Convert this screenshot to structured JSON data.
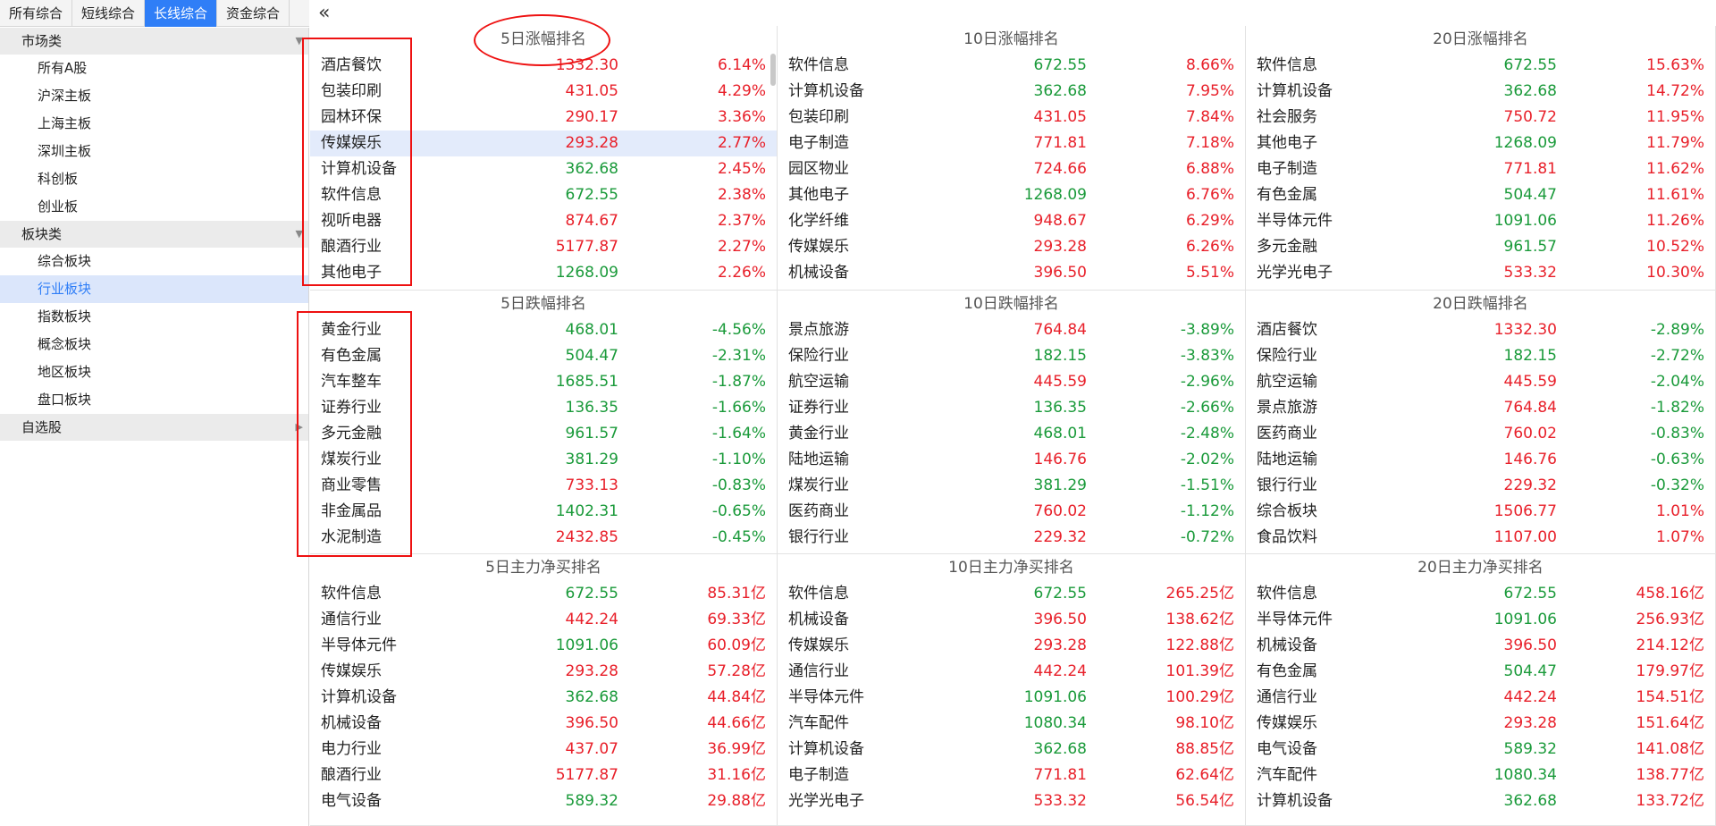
{
  "tabs": [
    "所有综合",
    "短线综合",
    "长线综合",
    "资金综合"
  ],
  "active_tab": 2,
  "collapse_glyph": "«",
  "sidebar": {
    "groups": [
      {
        "label": "市场类",
        "items": [
          "所有A股",
          "沪深主板",
          "上海主板",
          "深圳主板",
          "科创板",
          "创业板"
        ]
      },
      {
        "label": "板块类",
        "items": [
          "综合板块",
          "行业板块",
          "指数板块",
          "概念板块",
          "地区板块",
          "盘口板块"
        ]
      },
      {
        "label": "自选股",
        "items": []
      }
    ],
    "active_item": "行业板块"
  },
  "panels": [
    {
      "title": "5日涨幅排名",
      "rows": [
        [
          "酒店餐饮",
          "1332.30",
          "6.14%",
          "up",
          "up"
        ],
        [
          "包装印刷",
          "431.05",
          "4.29%",
          "up",
          "up"
        ],
        [
          "园林环保",
          "290.17",
          "3.36%",
          "up",
          "up"
        ],
        [
          "传媒娱乐",
          "293.28",
          "2.77%",
          "up",
          "up"
        ],
        [
          "计算机设备",
          "362.68",
          "2.45%",
          "dn",
          "up"
        ],
        [
          "软件信息",
          "672.55",
          "2.38%",
          "dn",
          "up"
        ],
        [
          "视听电器",
          "874.67",
          "2.37%",
          "up",
          "up"
        ],
        [
          "酿酒行业",
          "5177.87",
          "2.27%",
          "up",
          "up"
        ],
        [
          "其他电子",
          "1268.09",
          "2.26%",
          "dn",
          "up"
        ]
      ]
    },
    {
      "title": "10日涨幅排名",
      "rows": [
        [
          "软件信息",
          "672.55",
          "8.66%",
          "dn",
          "up"
        ],
        [
          "计算机设备",
          "362.68",
          "7.95%",
          "dn",
          "up"
        ],
        [
          "包装印刷",
          "431.05",
          "7.84%",
          "up",
          "up"
        ],
        [
          "电子制造",
          "771.81",
          "7.18%",
          "up",
          "up"
        ],
        [
          "园区物业",
          "724.66",
          "6.88%",
          "up",
          "up"
        ],
        [
          "其他电子",
          "1268.09",
          "6.76%",
          "dn",
          "up"
        ],
        [
          "化学纤维",
          "948.67",
          "6.29%",
          "up",
          "up"
        ],
        [
          "传媒娱乐",
          "293.28",
          "6.26%",
          "up",
          "up"
        ],
        [
          "机械设备",
          "396.50",
          "5.51%",
          "up",
          "up"
        ]
      ]
    },
    {
      "title": "20日涨幅排名",
      "rows": [
        [
          "软件信息",
          "672.55",
          "15.63%",
          "dn",
          "up"
        ],
        [
          "计算机设备",
          "362.68",
          "14.72%",
          "dn",
          "up"
        ],
        [
          "社会服务",
          "750.72",
          "11.95%",
          "up",
          "up"
        ],
        [
          "其他电子",
          "1268.09",
          "11.79%",
          "dn",
          "up"
        ],
        [
          "电子制造",
          "771.81",
          "11.62%",
          "up",
          "up"
        ],
        [
          "有色金属",
          "504.47",
          "11.61%",
          "dn",
          "up"
        ],
        [
          "半导体元件",
          "1091.06",
          "11.26%",
          "dn",
          "up"
        ],
        [
          "多元金融",
          "961.57",
          "10.52%",
          "dn",
          "up"
        ],
        [
          "光学光电子",
          "533.32",
          "10.30%",
          "up",
          "up"
        ]
      ]
    },
    {
      "title": "5日跌幅排名",
      "rows": [
        [
          "黄金行业",
          "468.01",
          "-4.56%",
          "dn",
          "dn"
        ],
        [
          "有色金属",
          "504.47",
          "-2.31%",
          "dn",
          "dn"
        ],
        [
          "汽车整车",
          "1685.51",
          "-1.87%",
          "dn",
          "dn"
        ],
        [
          "证券行业",
          "136.35",
          "-1.66%",
          "dn",
          "dn"
        ],
        [
          "多元金融",
          "961.57",
          "-1.64%",
          "dn",
          "dn"
        ],
        [
          "煤炭行业",
          "381.29",
          "-1.10%",
          "dn",
          "dn"
        ],
        [
          "商业零售",
          "733.13",
          "-0.83%",
          "up",
          "dn"
        ],
        [
          "非金属品",
          "1402.31",
          "-0.65%",
          "dn",
          "dn"
        ],
        [
          "水泥制造",
          "2432.85",
          "-0.45%",
          "up",
          "dn"
        ]
      ]
    },
    {
      "title": "10日跌幅排名",
      "rows": [
        [
          "景点旅游",
          "764.84",
          "-3.89%",
          "up",
          "dn"
        ],
        [
          "保险行业",
          "182.15",
          "-3.83%",
          "dn",
          "dn"
        ],
        [
          "航空运输",
          "445.59",
          "-2.96%",
          "up",
          "dn"
        ],
        [
          "证券行业",
          "136.35",
          "-2.66%",
          "dn",
          "dn"
        ],
        [
          "黄金行业",
          "468.01",
          "-2.48%",
          "dn",
          "dn"
        ],
        [
          "陆地运输",
          "146.76",
          "-2.02%",
          "up",
          "dn"
        ],
        [
          "煤炭行业",
          "381.29",
          "-1.51%",
          "dn",
          "dn"
        ],
        [
          "医药商业",
          "760.02",
          "-1.12%",
          "up",
          "dn"
        ],
        [
          "银行行业",
          "229.32",
          "-0.72%",
          "up",
          "dn"
        ]
      ]
    },
    {
      "title": "20日跌幅排名",
      "rows": [
        [
          "酒店餐饮",
          "1332.30",
          "-2.89%",
          "up",
          "dn"
        ],
        [
          "保险行业",
          "182.15",
          "-2.72%",
          "dn",
          "dn"
        ],
        [
          "航空运输",
          "445.59",
          "-2.04%",
          "up",
          "dn"
        ],
        [
          "景点旅游",
          "764.84",
          "-1.82%",
          "up",
          "dn"
        ],
        [
          "医药商业",
          "760.02",
          "-0.83%",
          "up",
          "dn"
        ],
        [
          "陆地运输",
          "146.76",
          "-0.63%",
          "up",
          "dn"
        ],
        [
          "银行行业",
          "229.32",
          "-0.32%",
          "up",
          "dn"
        ],
        [
          "综合板块",
          "1506.77",
          "1.01%",
          "up",
          "up"
        ],
        [
          "食品饮料",
          "1107.00",
          "1.07%",
          "up",
          "up"
        ]
      ]
    },
    {
      "title": "5日主力净买排名",
      "rows": [
        [
          "软件信息",
          "672.55",
          "85.31亿",
          "dn",
          "up"
        ],
        [
          "通信行业",
          "442.24",
          "69.33亿",
          "up",
          "up"
        ],
        [
          "半导体元件",
          "1091.06",
          "60.09亿",
          "dn",
          "up"
        ],
        [
          "传媒娱乐",
          "293.28",
          "57.28亿",
          "up",
          "up"
        ],
        [
          "计算机设备",
          "362.68",
          "44.84亿",
          "dn",
          "up"
        ],
        [
          "机械设备",
          "396.50",
          "44.66亿",
          "up",
          "up"
        ],
        [
          "电力行业",
          "437.07",
          "36.99亿",
          "up",
          "up"
        ],
        [
          "酿酒行业",
          "5177.87",
          "31.16亿",
          "up",
          "up"
        ],
        [
          "电气设备",
          "589.32",
          "29.88亿",
          "dn",
          "up"
        ]
      ]
    },
    {
      "title": "10日主力净买排名",
      "rows": [
        [
          "软件信息",
          "672.55",
          "265.25亿",
          "dn",
          "up"
        ],
        [
          "机械设备",
          "396.50",
          "138.62亿",
          "up",
          "up"
        ],
        [
          "传媒娱乐",
          "293.28",
          "122.88亿",
          "up",
          "up"
        ],
        [
          "通信行业",
          "442.24",
          "101.39亿",
          "up",
          "up"
        ],
        [
          "半导体元件",
          "1091.06",
          "100.29亿",
          "dn",
          "up"
        ],
        [
          "汽车配件",
          "1080.34",
          "98.10亿",
          "dn",
          "up"
        ],
        [
          "计算机设备",
          "362.68",
          "88.85亿",
          "dn",
          "up"
        ],
        [
          "电子制造",
          "771.81",
          "62.64亿",
          "up",
          "up"
        ],
        [
          "光学光电子",
          "533.32",
          "56.54亿",
          "up",
          "up"
        ]
      ]
    },
    {
      "title": "20日主力净买排名",
      "rows": [
        [
          "软件信息",
          "672.55",
          "458.16亿",
          "dn",
          "up"
        ],
        [
          "半导体元件",
          "1091.06",
          "256.93亿",
          "dn",
          "up"
        ],
        [
          "机械设备",
          "396.50",
          "214.12亿",
          "up",
          "up"
        ],
        [
          "有色金属",
          "504.47",
          "179.97亿",
          "dn",
          "up"
        ],
        [
          "通信行业",
          "442.24",
          "154.51亿",
          "up",
          "up"
        ],
        [
          "传媒娱乐",
          "293.28",
          "151.64亿",
          "up",
          "up"
        ],
        [
          "电气设备",
          "589.32",
          "141.08亿",
          "dn",
          "up"
        ],
        [
          "汽车配件",
          "1080.34",
          "138.77亿",
          "dn",
          "up"
        ],
        [
          "计算机设备",
          "362.68",
          "133.72亿",
          "dn",
          "up"
        ]
      ]
    }
  ],
  "colors": {
    "up": "#e8202a",
    "down": "#1a9a3a",
    "accent": "#2f7ef7"
  }
}
